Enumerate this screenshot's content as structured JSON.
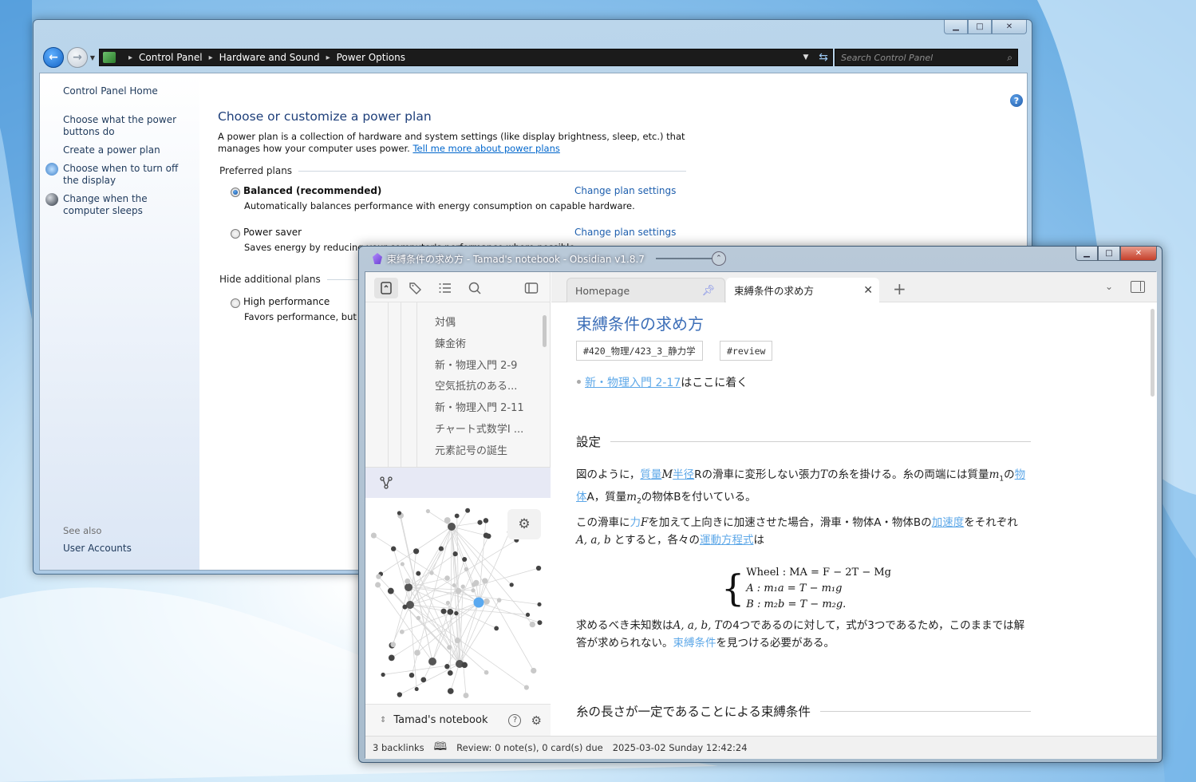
{
  "control_panel": {
    "breadcrumb": [
      "Control Panel",
      "Hardware and Sound",
      "Power Options"
    ],
    "search_placeholder": "Search Control Panel",
    "sidebar": {
      "home": "Control Panel Home",
      "links": [
        "Choose what the power buttons do",
        "Create a power plan",
        "Choose when to turn off the display",
        "Change when the computer sleeps"
      ],
      "see_also_label": "See also",
      "see_also_links": [
        "User Accounts"
      ]
    },
    "title": "Choose or customize a power plan",
    "description": "A power plan is a collection of hardware and system settings (like display brightness, sleep, etc.) that manages how your computer uses power.",
    "learn_more_link": "Tell me more about power plans",
    "preferred_label": "Preferred plans",
    "hidden_label": "Hide additional plans",
    "plans": [
      {
        "name": "Balanced (recommended)",
        "desc": "Automatically balances performance with energy consumption on capable hardware.",
        "link": "Change plan settings",
        "selected": true
      },
      {
        "name": "Power saver",
        "desc": "Saves energy by reducing your computer's performance where possible.",
        "link": "Change plan settings",
        "selected": false
      },
      {
        "name": "High performance",
        "desc": "Favors performance, but m",
        "selected": false
      }
    ]
  },
  "obsidian": {
    "window_title": "束縛条件の求め方 - Tamad's notebook - Obsidian v1.8.7",
    "file_tree": [
      "対偶",
      "錬金術",
      "新・物理入門 2-9",
      "空気抵抗のある...",
      "新・物理入門 2-11",
      "チャート式数学I ...",
      "元素記号の誕生"
    ],
    "vault_name": "Tamad's notebook",
    "tabs": [
      {
        "label": "Homepage",
        "active": false,
        "pinned": true
      },
      {
        "label": "束縛条件の求め方",
        "active": true
      }
    ],
    "note": {
      "title": "束縛条件の求め方",
      "tags": [
        "#420_物理/423_3_静力学",
        "#review"
      ],
      "bullet_link": "新・物理入門 2-17",
      "bullet_rest": "はここに着く",
      "heading1": "設定",
      "p1": {
        "t1": "図のように，",
        "l1": "質量",
        "t2": "M",
        "l2": "半径",
        "t3": "Rの滑車に変形しない張力",
        "t4": "T",
        "t5": "の糸を掛ける。糸の両端には質量",
        "t6": "m",
        "t6s": "1",
        "t7": "の",
        "l3": "物体",
        "t8": "A，質量",
        "t9": "m",
        "t9s": "2",
        "t10": "の物体Bを付いている。"
      },
      "p2": {
        "t1": "この滑車に",
        "l1": "力",
        "t2": "F",
        "t3": "を加えて上向きに加速させた場合，滑車・物体A・物体Bの",
        "l2": "加速度",
        "t4": "をそれぞれ ",
        "t5": "A, a, b",
        "t6": " とすると，各々の",
        "l3": "運動方程式",
        "t7": "は"
      },
      "equations": [
        "Wheel : MA = F − 2T − Mg",
        "A : m₁a = T − m₁g",
        "B : m₂b = T − m₂g."
      ],
      "p3": {
        "t1": "求めるべき未知数は",
        "t2": "A, a, b, T",
        "t3": "の4つであるのに対して，式が3つであるため，このままでは解答が求められない。",
        "l1": "束縛条件",
        "t4": "を見つける必要がある。"
      },
      "heading2": "糸の長さが一定であることによる束縛条件"
    },
    "status": {
      "backlinks": "3 backlinks",
      "review": "Review: 0 note(s), 0 card(s) due",
      "datetime": "2025-03-02 Sunday 12:42:24"
    }
  }
}
